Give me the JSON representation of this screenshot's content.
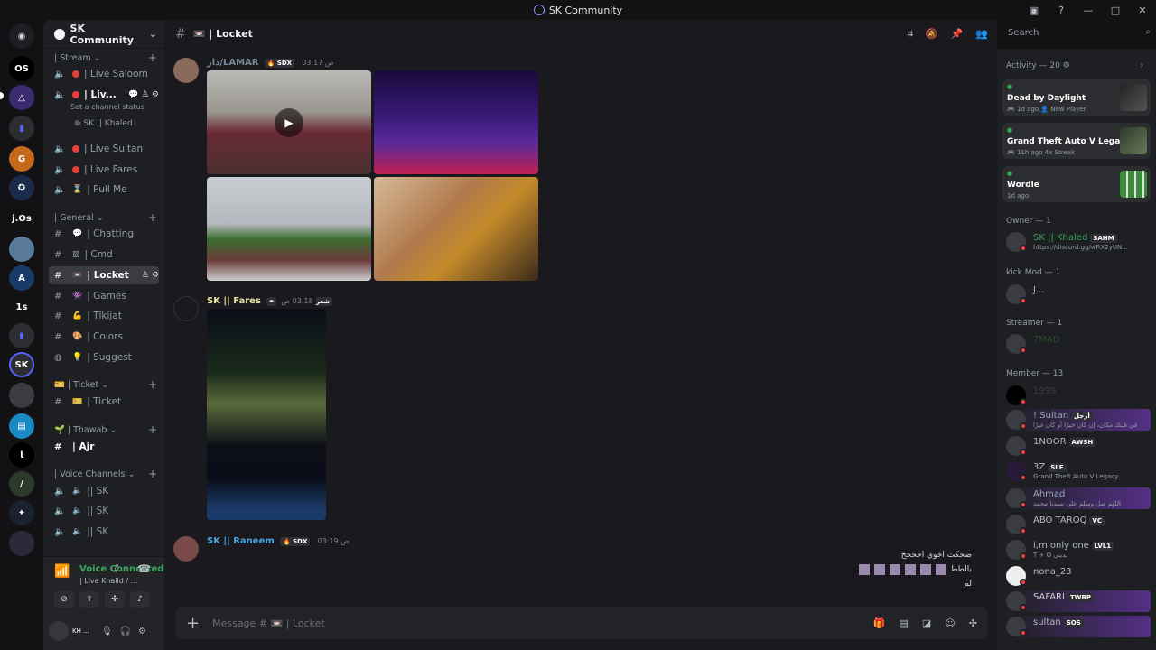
{
  "window": {
    "title": "SK Community"
  },
  "server": {
    "name": "SK Community"
  },
  "rail_labels": [
    "OS",
    "j.Os",
    "1s"
  ],
  "categories": {
    "stream": "| Stream",
    "general": "| General",
    "ticket": "| Ticket",
    "thawab": "| Thawab",
    "voice": "| Voice Channels"
  },
  "channels": {
    "live_saloom": "| Live Saloom",
    "live_khaild": "| Liv...",
    "channel_status": "Set a channel status",
    "khaled_in_voice": "SK || Khaled",
    "live_sultan": "| Live Sultan",
    "live_fares": "| Live Fares",
    "pull_me": "| Pull Me",
    "chatting": "| Chatting",
    "cmd": "| Cmd",
    "locket": "| Locket",
    "games": "| Games",
    "tlkijat": "| Tlkijat",
    "colors": "| Colors",
    "suggest": "| Suggest",
    "ticket": "| Ticket",
    "ajr": "| Ajr",
    "sk1": "|| SK",
    "sk2": "|| SK",
    "sk3": "|| SK"
  },
  "voice": {
    "title": "Voice Connected",
    "sub": "| Live Khaild / ..."
  },
  "user": {
    "name": "KH ..."
  },
  "chat": {
    "channel": "| Locket",
    "search_placeholder": "Search",
    "composer_placeholder": "Message # 📼 | Locket",
    "messages": [
      {
        "name": "دار/LAMAR",
        "tag": "SDX",
        "time": "03:17 ص"
      },
      {
        "name": "SK || Fares",
        "tag": "شعر",
        "time": "03:18 ص"
      },
      {
        "name": "SK || Raneem",
        "tag": "SDX",
        "time": "03:19 ص"
      }
    ],
    "raneem_lines": [
      "ضحكت اخوي احححح",
      "بالطط",
      "لم"
    ]
  },
  "activity": {
    "header": "Activity — 20",
    "cards": [
      {
        "game": "Dead by Daylight",
        "meta": "1d ago  👤 New Player"
      },
      {
        "game": "Grand Theft Auto V Legacy",
        "meta": "11h ago  4x Streak"
      },
      {
        "game": "Wordle",
        "meta": "1d ago"
      }
    ]
  },
  "member_groups": {
    "owner": "Owner — 1",
    "kickmod": "kick Mod — 1",
    "streamer": "Streamer — 1",
    "member": "Member — 13"
  },
  "members": {
    "khaled": {
      "name": "SK || Khaled",
      "badge": "SAHM",
      "sub": "https://discord.gg/wRX2yUN..."
    },
    "kickmod": {
      "name": "J..."
    },
    "streamer": {
      "name": "7MAD"
    },
    "m1999": {
      "name": "1999"
    },
    "sultan": {
      "name": "! Sultan",
      "badge": "أرجل",
      "sub": "في قلبك مكان، إن كان خيرًا أو كان غيرًا"
    },
    "noor": {
      "name": "1NOOR",
      "badge": "AWSH"
    },
    "z3": {
      "name": "3Z",
      "badge": "SLF",
      "sub": "Grand Theft Auto V Legacy"
    },
    "ahmad": {
      "name": "Ahmad",
      "sub": "اللهم صل وسلم على سيدنا محمد"
    },
    "abotaroq": {
      "name": "ABO TAROQ",
      "badge": "VC"
    },
    "imonlyone": {
      "name": "i,m only one",
      "badge": "LVL1",
      "sub": "T + O بديني"
    },
    "nona": {
      "name": "nona_23"
    },
    "safari": {
      "name": "SAFARI",
      "badge": "TWRP"
    },
    "sultan2": {
      "name": "sultan",
      "badge": "SOS"
    }
  }
}
